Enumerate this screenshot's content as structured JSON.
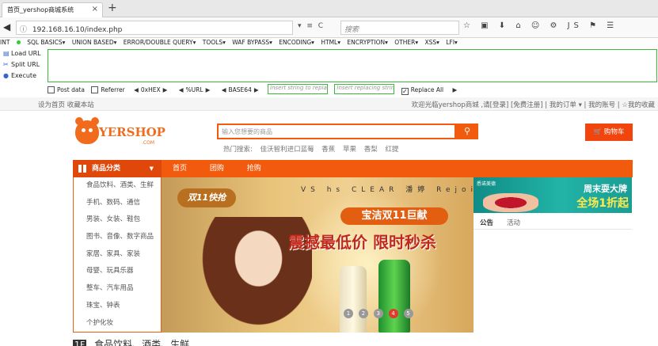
{
  "browser": {
    "tab_title": "首页_yershop商城系统",
    "tab_close": "×",
    "new_tab": "+",
    "back": "◀",
    "url_info": "ⓘ",
    "url": "192.168.16.10/index.php",
    "url_icons": "▾ ≡ C",
    "search_placeholder": "搜索",
    "nav_icons": "☆ ▣ ⬇ ⌂ ☺ ⚙ JS ⚑ ☰"
  },
  "hackbar": {
    "menu": [
      "INT",
      "SQL BASICS▾",
      "UNION BASED▾",
      "ERROR/DOUBLE QUERY▾",
      "TOOLS▾",
      "WAF BYPASS▾",
      "ENCODING▾",
      "HTML▾",
      "ENCRYPTION▾",
      "OTHER▾",
      "XSS▾",
      "LFI▾"
    ],
    "load_url": "Load URL",
    "split_url": "Split URL",
    "execute": "Execute",
    "post_data": "Post data",
    "referrer": "Referrer",
    "hex": "0xHEX",
    "url_enc": "%URL",
    "base64": "BASE64",
    "insert_string": "Insert string to replace",
    "insert_replacing": "Insert replacing string",
    "replace_all": "Replace All"
  },
  "site": {
    "topbar_left": "设为首页 收藏本站",
    "topbar_right": "欢迎光临yershop商城 ,请[登录] [免费注册]  |  我的订单 ▾  |  我的账号  |  ☆我的收藏",
    "logo_text": "YERSHOP",
    "logo_com": ".COM",
    "search_placeholder": "输入您想要的商品",
    "search_icon": "⚲",
    "hot_label": "热门搜索:",
    "hot_words": [
      "佳沃智利进口蓝莓",
      "香蕉",
      "苹果",
      "香梨",
      "红提"
    ],
    "cart": "🛒 购物车",
    "category_title": "商品分类",
    "category_arrow": "▼",
    "nav_links": [
      "首页",
      "团购",
      "抢购"
    ],
    "categories": [
      "食品饮料、酒类、生鲜",
      "手机、数码、通信",
      "男装、女装、鞋包",
      "图书、音像、数字商品",
      "家居、家具、家装",
      "母婴、玩具乐器",
      "整车、汽车用品",
      "珠宝、钟表",
      "个护化妆"
    ],
    "banner": {
      "logos": "VS hs CLEAR 潘婷 Rejoice 伊卡璐",
      "tag": "双11快抢",
      "sub": "宝洁双11巨献",
      "headline": "震撼最低价 限时秒杀",
      "dots": [
        "1",
        "2",
        "3",
        "4",
        "5"
      ]
    },
    "side_ad": {
      "brand": "悉诺美德",
      "line1": "周末耍大牌",
      "line2": "全场1折起"
    },
    "news_tabs": [
      "公告",
      "活动"
    ],
    "floor_num": "1F",
    "floor_title": "食品饮料、酒类、生鲜"
  }
}
